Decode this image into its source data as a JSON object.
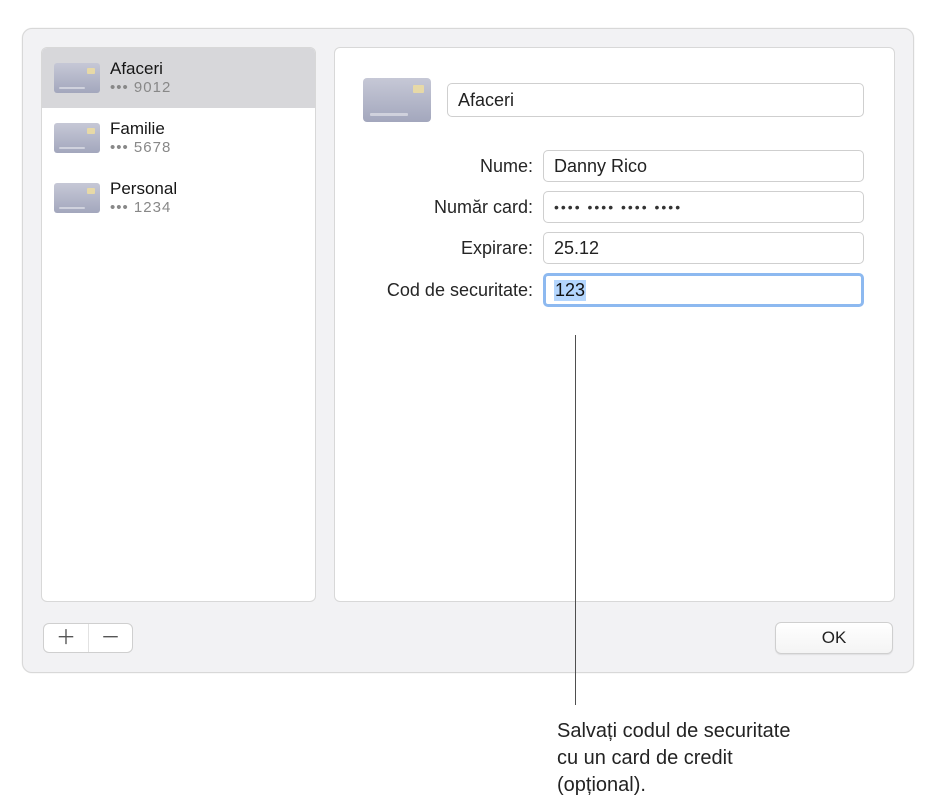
{
  "sidebar": {
    "cards": [
      {
        "name": "Afaceri",
        "mask": "••• 9012",
        "selected": true
      },
      {
        "name": "Familie",
        "mask": "••• 5678",
        "selected": false
      },
      {
        "name": "Personal",
        "mask": "••• 1234",
        "selected": false
      }
    ]
  },
  "detail": {
    "title": "Afaceri",
    "rows": {
      "name_label": "Nume:",
      "name_value": "Danny Rico",
      "number_label": "Număr card:",
      "number_value": "•••• •••• •••• ••••",
      "expiry_label": "Expirare:",
      "expiry_value": "25.12",
      "security_label": "Cod de securitate:",
      "security_value": "123"
    }
  },
  "buttons": {
    "ok": "OK",
    "plus": "＋",
    "minus": "－"
  },
  "callout": "Salvați codul de securitate cu un card de credit (opțional)."
}
